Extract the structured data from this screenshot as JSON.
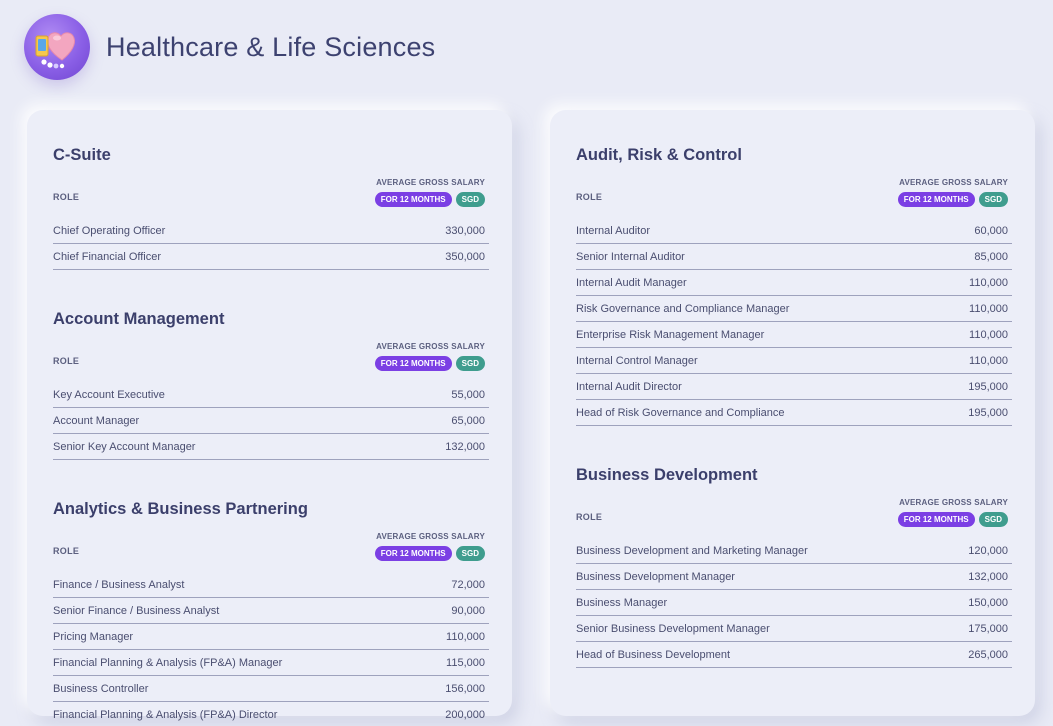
{
  "header": {
    "title": "Healthcare & Life Sciences",
    "icon": "healthcare-illustration-icon"
  },
  "table_labels": {
    "role": "ROLE",
    "salary": "AVERAGE GROSS SALARY",
    "period_badge": "FOR 12 MONTHS",
    "currency_badge": "SGD"
  },
  "colors": {
    "period_badge": "#7b3fe4",
    "currency_badge": "#3f9d8e",
    "background": "#e9ebf6"
  },
  "left_sections": [
    {
      "title": "C-Suite",
      "rows": [
        {
          "role": "Chief Operating Officer",
          "salary": "330,000"
        },
        {
          "role": "Chief Financial Officer",
          "salary": "350,000"
        }
      ]
    },
    {
      "title": "Account Management",
      "rows": [
        {
          "role": "Key Account Executive",
          "salary": "55,000"
        },
        {
          "role": "Account Manager",
          "salary": "65,000"
        },
        {
          "role": "Senior Key Account Manager",
          "salary": "132,000"
        }
      ]
    },
    {
      "title": "Analytics & Business Partnering",
      "rows": [
        {
          "role": "Finance / Business Analyst",
          "salary": "72,000"
        },
        {
          "role": "Senior Finance / Business Analyst",
          "salary": "90,000"
        },
        {
          "role": "Pricing Manager",
          "salary": "110,000"
        },
        {
          "role": "Financial Planning & Analysis (FP&A) Manager",
          "salary": "115,000"
        },
        {
          "role": "Business Controller",
          "salary": "156,000"
        },
        {
          "role": "Financial Planning & Analysis (FP&A) Director",
          "salary": "200,000"
        }
      ]
    }
  ],
  "right_sections": [
    {
      "title": "Audit, Risk & Control",
      "rows": [
        {
          "role": "Internal Auditor",
          "salary": "60,000"
        },
        {
          "role": "Senior Internal Auditor",
          "salary": "85,000"
        },
        {
          "role": "Internal Audit Manager",
          "salary": "110,000"
        },
        {
          "role": "Risk Governance and Compliance Manager",
          "salary": "110,000"
        },
        {
          "role": "Enterprise Risk Management Manager",
          "salary": "110,000"
        },
        {
          "role": "Internal Control Manager",
          "salary": "110,000"
        },
        {
          "role": "Internal Audit Director",
          "salary": "195,000"
        },
        {
          "role": "Head of Risk Governance and Compliance",
          "salary": "195,000"
        }
      ]
    },
    {
      "title": "Business Development",
      "rows": [
        {
          "role": "Business Development and Marketing Manager",
          "salary": "120,000"
        },
        {
          "role": "Business Development Manager",
          "salary": "132,000"
        },
        {
          "role": "Business Manager",
          "salary": "150,000"
        },
        {
          "role": "Senior Business Development Manager",
          "salary": "175,000"
        },
        {
          "role": "Head of Business Development",
          "salary": "265,000"
        }
      ]
    }
  ]
}
